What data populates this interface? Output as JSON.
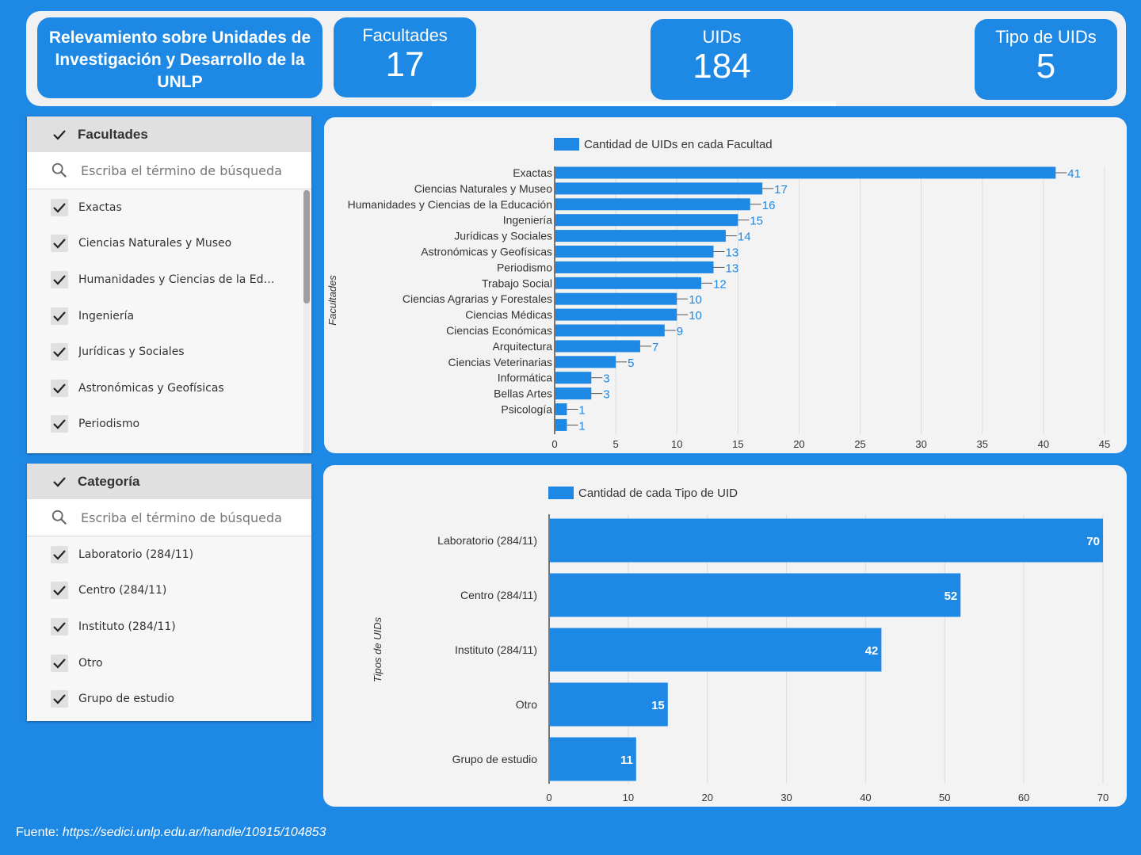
{
  "header": {
    "title": "Relevamiento sobre Unidades de Investigación y Desarrollo de la UNLP",
    "kpis": [
      {
        "label": "Facultades",
        "value": "17"
      },
      {
        "label": "UIDs",
        "value": "184"
      },
      {
        "label": "Tipo de UIDs",
        "value": "5"
      }
    ]
  },
  "filters": {
    "facultades": {
      "title": "Facultades",
      "search_placeholder": "Escriba el término de búsqueda",
      "options": [
        "Exactas",
        "Ciencias Naturales y Museo",
        "Humanidades y Ciencias de la Educ...",
        "Ingeniería",
        "Jurídicas y Sociales",
        "Astronómicas y Geofísicas",
        "Periodismo"
      ]
    },
    "categoria": {
      "title": "Categoría",
      "search_placeholder": "Escriba el término de búsqueda",
      "options": [
        "Laboratorio (284/11)",
        "Centro (284/11)",
        "Instituto (284/11)",
        "Otro",
        "Grupo de estudio"
      ]
    }
  },
  "colors": {
    "accent": "#1e88e5",
    "card": "#f3f3f3",
    "header_bg": "#f1f1f1"
  },
  "chart_data": [
    {
      "type": "bar",
      "orientation": "horizontal",
      "legend": "Cantidad de UIDs en cada Facultad",
      "ylabel": "Facultades",
      "categories": [
        "Exactas",
        "Ciencias Naturales y Museo",
        "Humanidades y Ciencias de la Educación",
        "Ingeniería",
        "Jurídicas y Sociales",
        "Astronómicas y Geofísicas",
        "Periodismo",
        "Trabajo Social",
        "Ciencias Agrarias y Forestales",
        "Ciencias Médicas",
        "Ciencias Económicas",
        "Arquitectura",
        "Ciencias Veterinarias",
        "Informática",
        "Bellas Artes",
        "Psicología",
        ""
      ],
      "values": [
        41,
        17,
        16,
        15,
        14,
        13,
        13,
        12,
        10,
        10,
        9,
        7,
        5,
        3,
        3,
        1,
        1
      ],
      "xlim": [
        0,
        45
      ],
      "xticks": [
        0,
        5,
        10,
        15,
        20,
        25,
        30,
        35,
        40,
        45
      ]
    },
    {
      "type": "bar",
      "orientation": "horizontal",
      "legend": "Cantidad de cada Tipo de UID",
      "ylabel": "Tipos de UIDs",
      "categories": [
        "Laboratorio (284/11)",
        "Centro (284/11)",
        "Instituto (284/11)",
        "Otro",
        "Grupo de estudio"
      ],
      "values": [
        70,
        52,
        42,
        15,
        11
      ],
      "xlim": [
        0,
        70
      ],
      "xticks": [
        0,
        10,
        20,
        30,
        40,
        50,
        60,
        70
      ]
    }
  ],
  "footer": {
    "source_label": "Fuente:",
    "source_url": "https://sedici.unlp.edu.ar/handle/10915/104853"
  }
}
